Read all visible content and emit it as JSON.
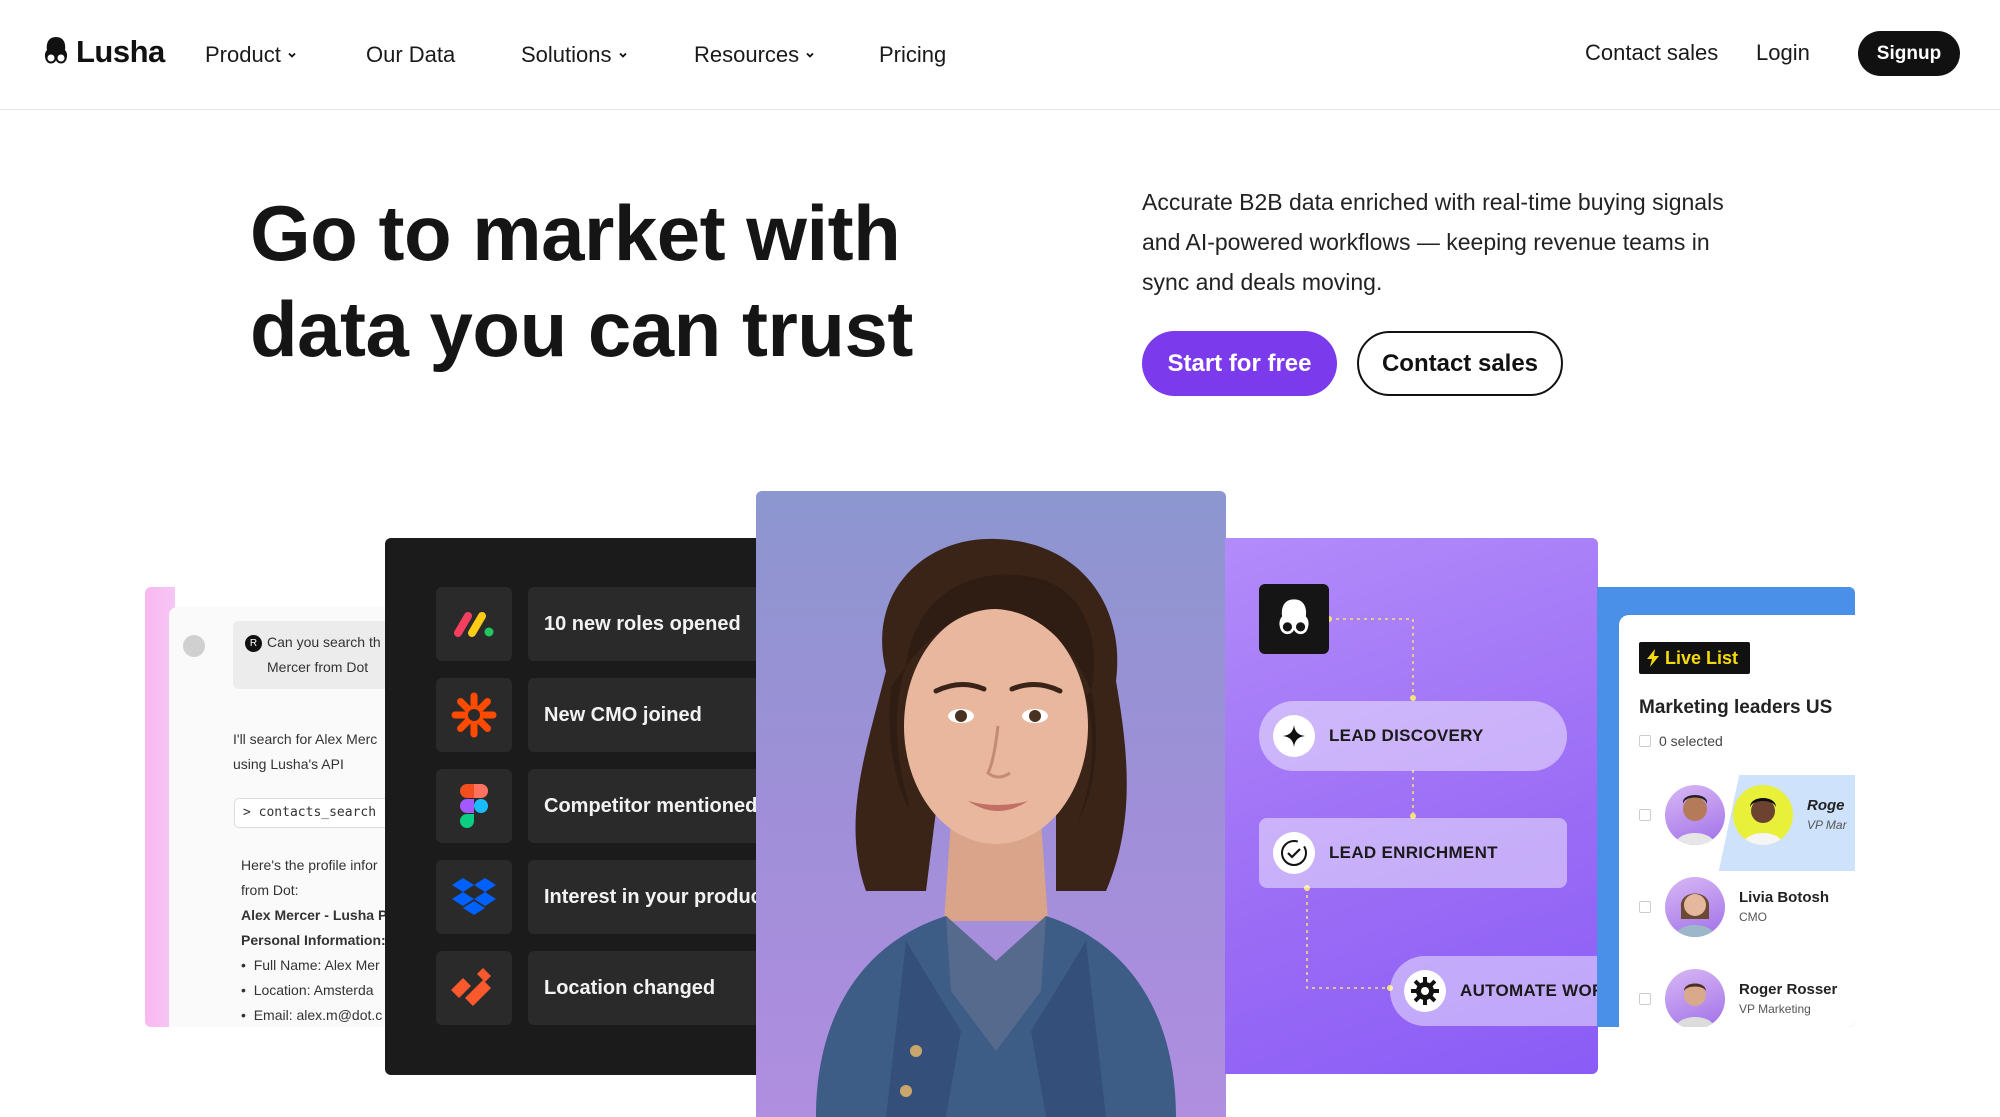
{
  "nav": {
    "brand": "Lusha",
    "items": [
      {
        "label": "Product",
        "dropdown": true
      },
      {
        "label": "Our Data",
        "dropdown": false
      },
      {
        "label": "Solutions",
        "dropdown": true
      },
      {
        "label": "Resources",
        "dropdown": true
      },
      {
        "label": "Pricing",
        "dropdown": false
      }
    ],
    "contact_sales": "Contact sales",
    "login": "Login",
    "signup": "Signup"
  },
  "hero": {
    "title_line1": "Go to market with",
    "title_line2": "data you can trust",
    "description": "Accurate B2B data enriched with real-time buying signals and AI-powered workflows — keeping revenue teams in sync and deals moving.",
    "cta_primary": "Start for free",
    "cta_secondary": "Contact sales"
  },
  "chat_card": {
    "question": "Can you search the Mercer from Dot",
    "question_line1": "Can you search th",
    "question_line2": "Mercer from Dot",
    "answer_line1": "I'll search for Alex Merc",
    "answer_line2": "using Lusha's API",
    "command": "> contacts_search ✓",
    "result_line1": "Here's the profile infor",
    "result_line2": "from Dot:",
    "result_name": "Alex Mercer - Lusha P",
    "result_section": "Personal Information:",
    "bullets": [
      "Full Name: Alex Mer",
      "Location: Amsterda",
      "Email: alex.m@dot.c"
    ]
  },
  "signals_card": {
    "items": [
      {
        "label": "10 new roles opened",
        "icon": "monday-icon"
      },
      {
        "label": "New CMO joined",
        "icon": "zapier-icon"
      },
      {
        "label": "Competitor mentioned",
        "icon": "figma-icon"
      },
      {
        "label": "Interest in your  product",
        "icon": "dropbox-icon"
      },
      {
        "label": "Location changed",
        "icon": "paloalto-icon"
      }
    ]
  },
  "flow_card": {
    "steps": [
      {
        "label": "LEAD DISCOVERY",
        "icon": "sparkle-icon"
      },
      {
        "label": "LEAD ENRICHMENT",
        "icon": "check-circle-icon"
      },
      {
        "label": "AUTOMATE WOR",
        "icon": "gear-icon"
      }
    ],
    "accent": "#8b5cf6"
  },
  "list_card": {
    "badge": "Live List",
    "title": "Marketing leaders US",
    "selected": "0 selected",
    "people": [
      {
        "name": "Roge",
        "role": "VP Mar"
      },
      {
        "name": "Livia Botosh",
        "role": "CMO"
      },
      {
        "name": "Roger Rosser",
        "role": "VP Marketing"
      }
    ]
  },
  "colors": {
    "primary": "#7c3aed",
    "dark": "#111111",
    "live_badge_text": "#f5d90a"
  }
}
